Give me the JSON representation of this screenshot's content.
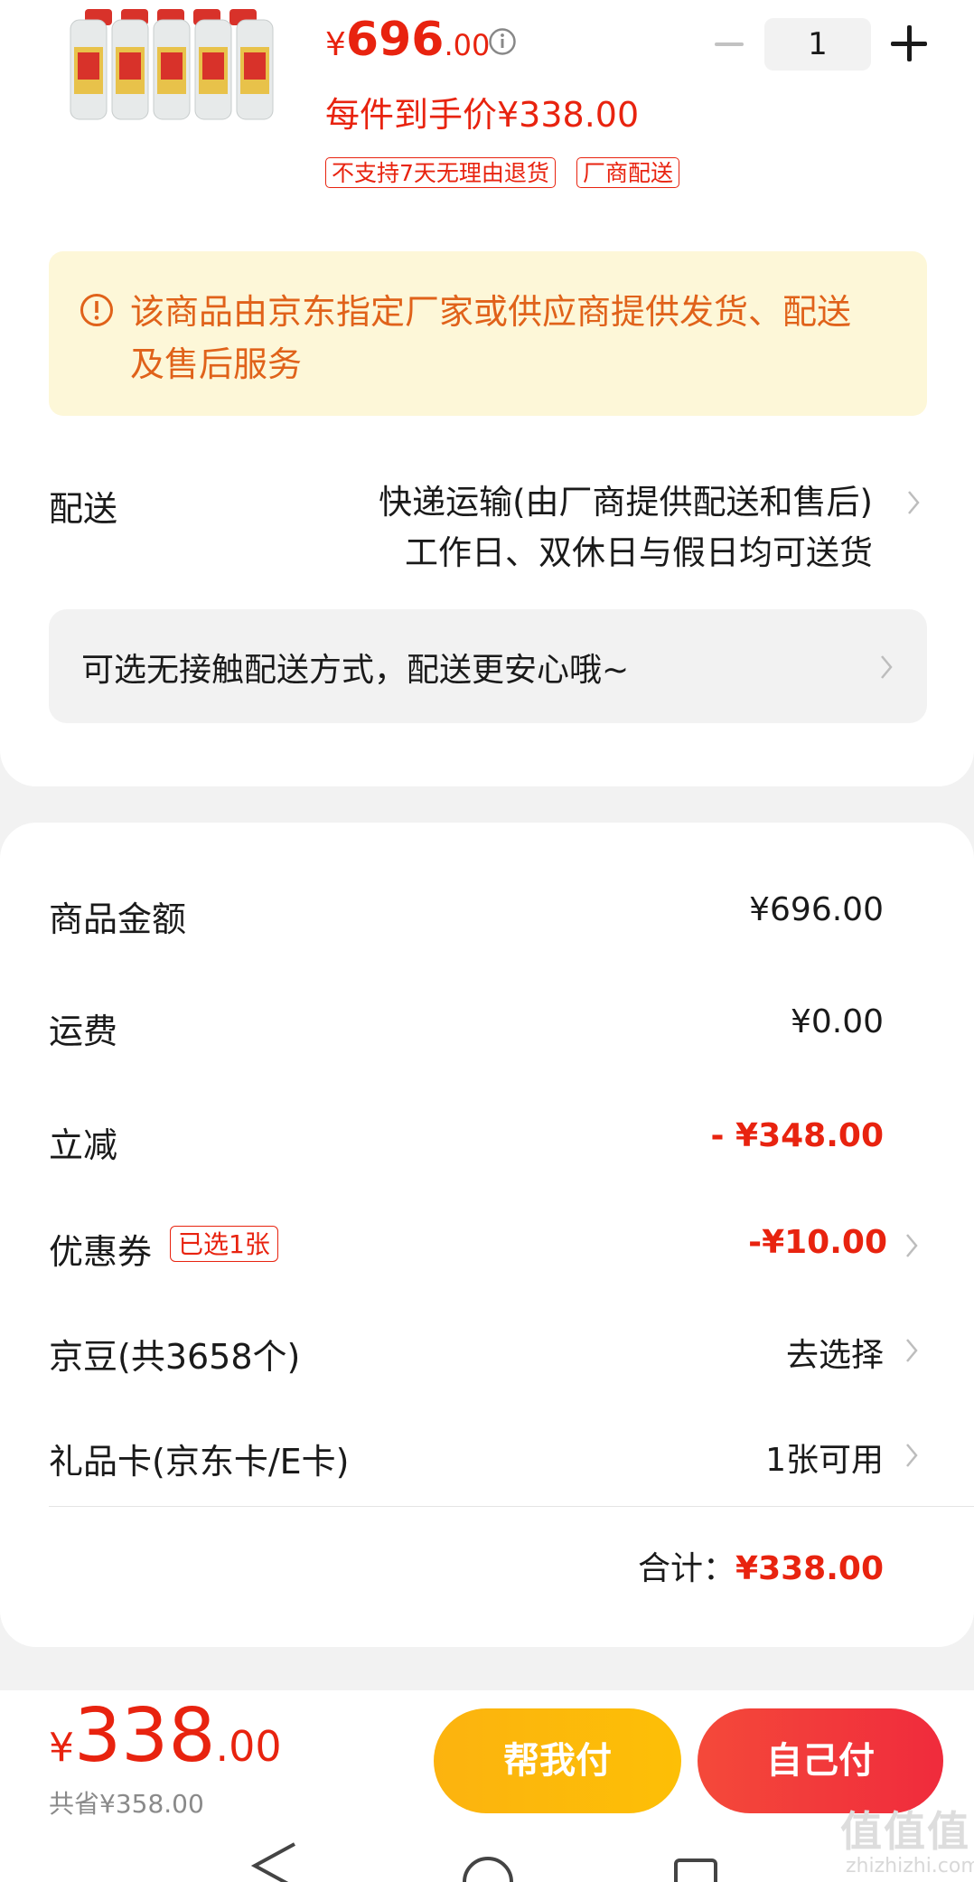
{
  "product": {
    "price_symbol": "¥",
    "price_int": "696",
    "price_dec": ".00",
    "per_item_price": "每件到手价¥338.00",
    "tags": [
      "不支持7天无理由退货",
      "厂商配送"
    ],
    "quantity": "1"
  },
  "notice": {
    "text": "该商品由京东指定厂家或供应商提供发货、配送及售后服务"
  },
  "delivery": {
    "label": "配送",
    "method": "快递运输(由厂商提供配送和售后)",
    "schedule": "工作日、双休日与假日均可送货",
    "contactless": "可选无接触配送方式，配送更安心哦~"
  },
  "summary": {
    "goods_label": "商品金额",
    "goods_value": "¥696.00",
    "shipping_label": "运费",
    "shipping_value": "¥0.00",
    "discount_label": "立减",
    "discount_value": "- ¥348.00",
    "coupon_label": "优惠券",
    "coupon_tag": "已选1张",
    "coupon_value": "-¥10.00",
    "beans_label": "京豆(共3658个)",
    "beans_value": "去选择",
    "giftcard_label": "礼品卡(京东卡/E卡)",
    "giftcard_value": "1张可用",
    "total_label": "合计：",
    "total_value": "¥338.00"
  },
  "bottom": {
    "price_symbol": "¥",
    "price_int": "338",
    "price_dec": ".00",
    "saved": "共省¥358.00",
    "help_pay": "帮我付",
    "self_pay": "自己付"
  },
  "watermark": {
    "text": "值值值",
    "url": "zhizhizhi.com"
  },
  "colors": {
    "accent_red": "#e8230f",
    "notice_bg": "#fdf7d8",
    "notice_text": "#e0621a",
    "help_btn": "#fdb90a",
    "self_btn": "#f23a3b"
  }
}
